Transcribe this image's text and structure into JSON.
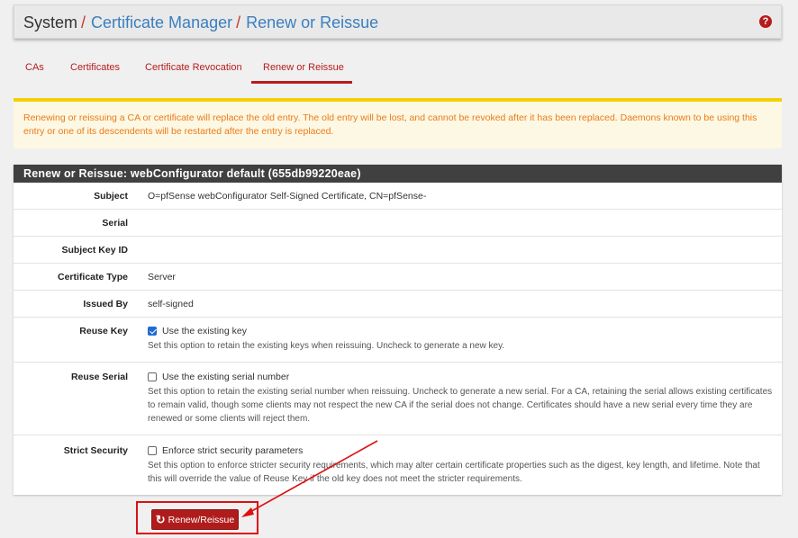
{
  "breadcrumb": {
    "root": "System",
    "separator": "/",
    "items": [
      "Certificate Manager",
      "Renew or Reissue"
    ]
  },
  "help_icon": "?",
  "tabs": [
    {
      "label": "CAs",
      "active": false
    },
    {
      "label": "Certificates",
      "active": false
    },
    {
      "label": "Certificate Revocation",
      "active": false
    },
    {
      "label": "Renew or Reissue",
      "active": true
    }
  ],
  "warning": "Renewing or reissuing a CA or certificate will replace the old entry. The old entry will be lost, and cannot be revoked after it has been replaced. Daemons known to be using this entry or one of its descendents will be restarted after the entry is replaced.",
  "panel": {
    "title": "Renew or Reissue: webConfigurator default (655db99220eae)",
    "fields": {
      "subject": {
        "label": "Subject",
        "value": "O=pfSense webConfigurator Self-Signed Certificate, CN=pfSense-"
      },
      "serial": {
        "label": "Serial",
        "value": ""
      },
      "subject_key_id": {
        "label": "Subject Key ID",
        "value": ""
      },
      "cert_type": {
        "label": "Certificate Type",
        "value": "Server"
      },
      "issued_by": {
        "label": "Issued By",
        "value": "self-signed"
      },
      "reuse_key": {
        "label": "Reuse Key",
        "checkbox_label": "Use the existing key",
        "checked": true,
        "help": "Set this option to retain the existing keys when reissuing. Uncheck to generate a new key."
      },
      "reuse_serial": {
        "label": "Reuse Serial",
        "checkbox_label": "Use the existing serial number",
        "checked": false,
        "help": "Set this option to retain the existing serial number when reissuing. Uncheck to generate a new serial. For a CA, retaining the serial allows existing certificates to remain valid, though some clients may not respect the new CA if the serial does not change. Certificates should have a new serial every time they are renewed or some clients will reject them."
      },
      "strict_security": {
        "label": "Strict Security",
        "checkbox_label": "Enforce strict security parameters",
        "checked": false,
        "help": "Set this option to enforce stricter security requirements, which may alter certain certificate properties such as the digest, key length, and lifetime. Note that this will override the value of Reuse Key if the old key does not meet the stricter requirements."
      }
    }
  },
  "renew_button": {
    "label": "Renew/Reissue",
    "icon": "refresh-icon"
  },
  "colors": {
    "accent": "#b71c1c",
    "link": "#3a7fbf",
    "warning_text": "#ec7a1b",
    "warning_bg": "#fcf8e3",
    "panel_heading": "#404040",
    "annotation": "#dd1111"
  }
}
